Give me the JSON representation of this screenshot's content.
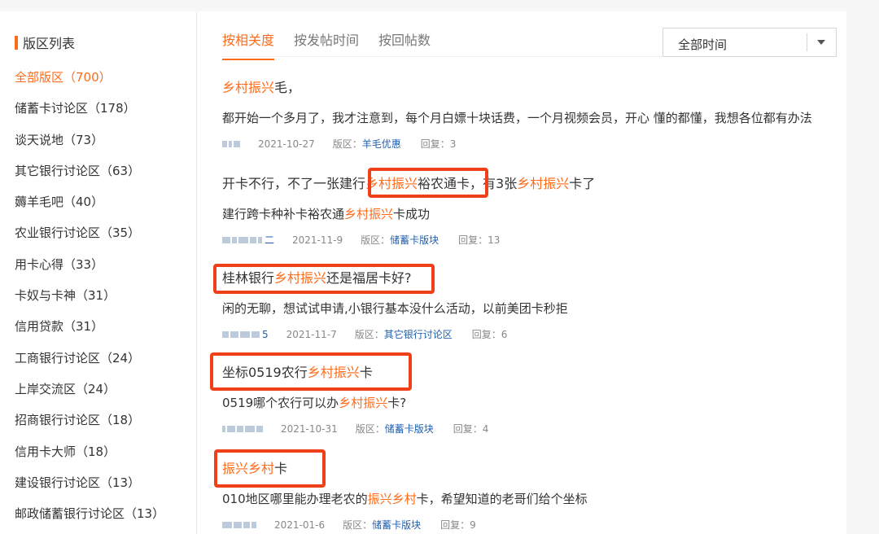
{
  "sidebar": {
    "title": "版区列表",
    "items": [
      "全部版区（700）",
      "储蓄卡讨论区（178）",
      "谈天说地（73）",
      "其它银行讨论区（63）",
      "薅羊毛吧（40）",
      "农业银行讨论区（35）",
      "用卡心得（33）",
      "卡奴与卡神（31）",
      "信用贷款（31）",
      "工商银行讨论区（24）",
      "上岸交流区（24）",
      "招商银行讨论区（18）",
      "信用卡大师（18）",
      "建设银行讨论区（13）",
      "邮政储蓄银行讨论区（13）"
    ]
  },
  "tabs": [
    "按相关度",
    "按发帖时间",
    "按回帖数"
  ],
  "time_select": {
    "value": "全部时间"
  },
  "labels": {
    "board": "版区：",
    "reply": "回复："
  },
  "results": [
    {
      "title": [
        {
          "t": "乡村振兴",
          "hl": true
        },
        {
          "t": "毛，",
          "hl": false
        }
      ],
      "desc": [
        {
          "t": "都开始一个多月了，我才注意到，每个月白嫖十块话费，一个月视频会员，开心 懂的都懂，我想各位都有办法",
          "hl": false
        }
      ],
      "author_suffix": "",
      "date": "2021-10-27",
      "board": "羊毛优惠",
      "reply": "3"
    },
    {
      "title": [
        {
          "t": "开卡不行，不了一张建行",
          "hl": false
        },
        {
          "t": "乡村振兴",
          "hl": true
        },
        {
          "t": "裕农通卡，有3张",
          "hl": false
        },
        {
          "t": "乡村振兴",
          "hl": true
        },
        {
          "t": "卡了",
          "hl": false
        }
      ],
      "desc": [
        {
          "t": "建行跨卡种补卡裕农通",
          "hl": false
        },
        {
          "t": "乡村振兴",
          "hl": true
        },
        {
          "t": "卡成功",
          "hl": false
        }
      ],
      "author_suffix": "二",
      "date": "2021-11-9",
      "board": "储蓄卡版块",
      "reply": "13"
    },
    {
      "title": [
        {
          "t": "桂林银行",
          "hl": false
        },
        {
          "t": "乡村振兴",
          "hl": true
        },
        {
          "t": "还是福居卡好?",
          "hl": false
        }
      ],
      "desc": [
        {
          "t": "闲的无聊，想试试申请,小银行基本没什么活动，以前美团卡秒拒",
          "hl": false
        }
      ],
      "author_suffix": "5",
      "date": "2021-11-7",
      "board": "其它银行讨论区",
      "reply": "6"
    },
    {
      "title": [
        {
          "t": "坐标0519农行",
          "hl": false
        },
        {
          "t": "乡村振兴",
          "hl": true
        },
        {
          "t": "卡",
          "hl": false
        }
      ],
      "desc": [
        {
          "t": "0519哪个农行可以办",
          "hl": false
        },
        {
          "t": "乡村振兴",
          "hl": true
        },
        {
          "t": "卡?",
          "hl": false
        }
      ],
      "author_suffix": "",
      "date": "2021-10-31",
      "board": "储蓄卡版块",
      "reply": "4"
    },
    {
      "title": [
        {
          "t": "振兴乡村",
          "hl": true
        },
        {
          "t": "卡",
          "hl": false
        }
      ],
      "desc": [
        {
          "t": "010地区哪里能办理老农的",
          "hl": false
        },
        {
          "t": "振兴乡村",
          "hl": true
        },
        {
          "t": "卡，希望知道的老哥们给个坐标",
          "hl": false
        }
      ],
      "author_suffix": "",
      "date": "2021-01-6",
      "board": "储蓄卡版块",
      "reply": "9"
    }
  ],
  "colors": {
    "accent": "#ff6b1a",
    "link": "#1f5fae",
    "redbox": "#f0401a"
  }
}
